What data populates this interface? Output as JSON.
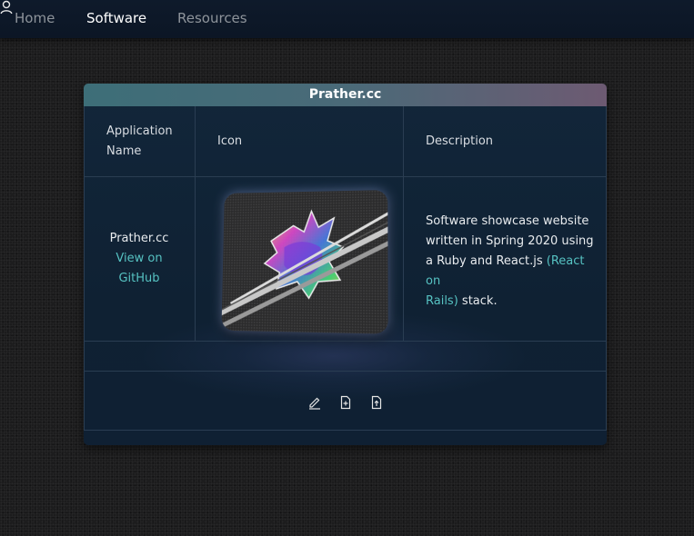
{
  "nav": {
    "home": "Home",
    "software": "Software",
    "resources": "Resources",
    "user_icon": "user-icon"
  },
  "card": {
    "title": "Prather.cc",
    "columns": {
      "app_name_line1": "Application",
      "app_name_line2": "Name",
      "icon": "Icon",
      "description": "Description"
    },
    "row": {
      "name": "Prather.cc",
      "link_line1": "View on",
      "link_line2": "GitHub",
      "desc_line1": "Software showcase website",
      "desc_line2": "written in Spring 2020 using",
      "desc_line3_text": "a Ruby and React.js ",
      "desc_line3_link": "(React on",
      "desc_line4_link": "Rails)",
      "desc_line4_text": " stack."
    },
    "toolbar": {
      "edit_icon": "pencil-icon",
      "add_icon": "file-plus-icon",
      "export_icon": "file-export-icon"
    }
  },
  "colors": {
    "navbar": "#0e1a2b",
    "card": "#12263a",
    "accent_link": "#56c2c2",
    "header_left": "#3d6e78",
    "header_right": "#6d5a72"
  }
}
